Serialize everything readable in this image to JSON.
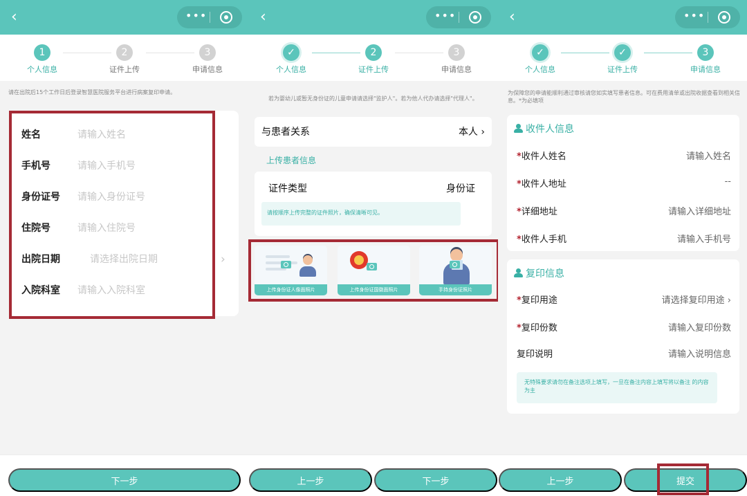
{
  "steps": [
    {
      "number": "1",
      "label": "个人信息"
    },
    {
      "number": "2",
      "label": "证件上传"
    },
    {
      "number": "3",
      "label": "申请信息"
    }
  ],
  "colors": {
    "primary": "#5bc5bb",
    "text_primary": "#39b0a5",
    "highlight": "#a52a35"
  },
  "screen1": {
    "notice": "请在出院后15个工作日后登录智慧医院服务平台进行病案复印申请。",
    "fields": [
      {
        "label": "姓名",
        "placeholder": "请输入姓名"
      },
      {
        "label": "手机号",
        "placeholder": "请输入手机号"
      },
      {
        "label": "身份证号",
        "placeholder": "请输入身份证号"
      },
      {
        "label": "住院号",
        "placeholder": "请输入住院号"
      },
      {
        "label": "出院日期",
        "placeholder": "请选择出院日期"
      },
      {
        "label": "入院科室",
        "placeholder": "请输入入院科室"
      }
    ],
    "next_button": "下一步"
  },
  "screen2": {
    "notice": "若为婴幼儿或暂无身份证的儿童申请请选择\"监护人\"。若为他人代办请选择\"代理人\"。",
    "relation_label": "与患者关系",
    "relation_value": "本人",
    "section_title": "上传患者信息",
    "document_type_label": "证件类型",
    "document_type_value": "身份证",
    "upload_tip": "请按顺序上传完整的证件照片，确保清晰可见。",
    "upload_cards": [
      "上传身份证人像面照片",
      "上传身份证国徽面照片",
      "手持身份证照片"
    ],
    "prev_button": "上一步",
    "next_button": "下一步"
  },
  "screen3": {
    "notice": "为保障您的申请能顺利通过审核请您如实填写患者信息。可在费用清单或出院收据查看到相关信息。*为必填项",
    "recipient_title": "收件人信息",
    "recipient_fields": [
      {
        "required": "*",
        "label": "收件人姓名",
        "value": "请输入姓名"
      },
      {
        "required": "*",
        "label": "收件人地址",
        "value": "--"
      },
      {
        "required": "*",
        "label": "详细地址",
        "value": "请输入详细地址"
      },
      {
        "required": "*",
        "label": "收件人手机",
        "value": "请输入手机号"
      }
    ],
    "copy_title": "复印信息",
    "copy_fields": [
      {
        "required": "*",
        "label": "复印用途",
        "value": "请选择复印用途"
      },
      {
        "required": "*",
        "label": "复印份数",
        "value": "请输入复印份数"
      },
      {
        "required": "",
        "label": "复印说明",
        "value": "请输入说明信息"
      }
    ],
    "copy_tip": "无特殊要求请勿在备注选项上填写，一旦在备注内容上填写将以备注 的内容为主",
    "prev_button": "上一步",
    "submit_button": "提交"
  },
  "icons": [
    "back-arrow-icon",
    "more-dots-icon",
    "close-target-icon",
    "camera-icon",
    "person-icon"
  ]
}
